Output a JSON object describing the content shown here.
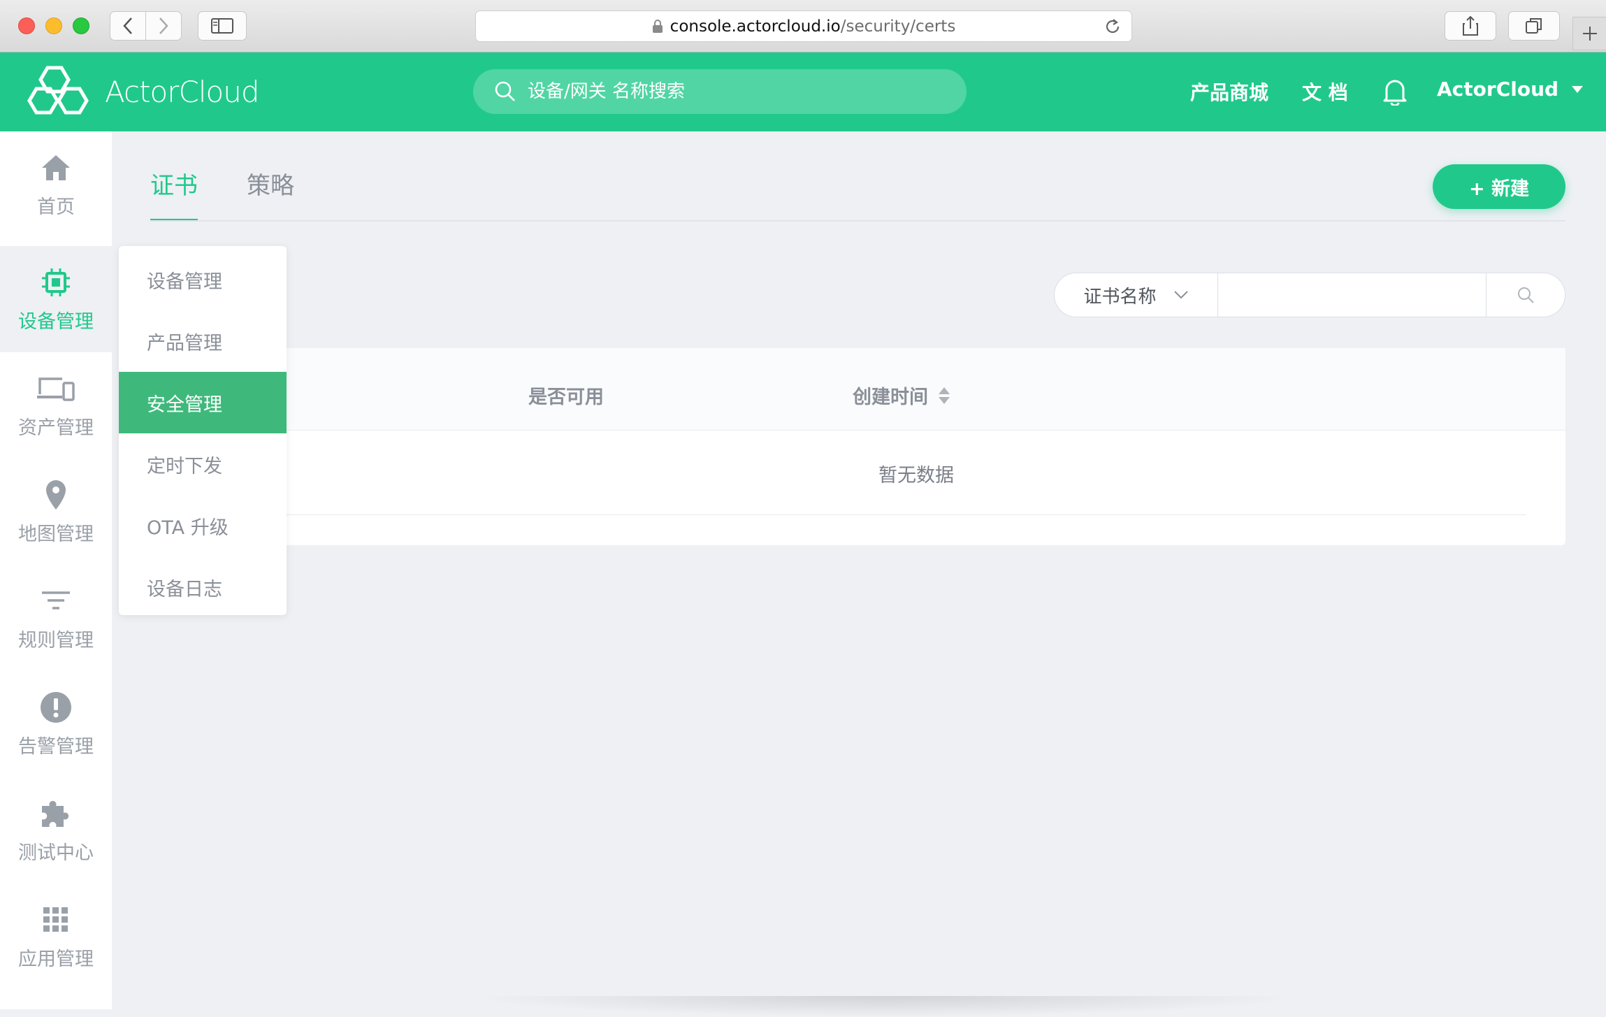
{
  "browser": {
    "url_host": "console.actorcloud.io",
    "url_path": "/security/certs"
  },
  "header": {
    "logo_text": "ActorCloud",
    "search_placeholder": "设备/网关 名称搜索",
    "nav_store": "产品商城",
    "nav_docs": "文 档",
    "user_name": "ActorCloud",
    "brand_color": "#20c98b"
  },
  "sidebar": {
    "items": [
      {
        "label": "首页",
        "icon": "home-icon"
      },
      {
        "label": "设备管理",
        "icon": "chip-icon"
      },
      {
        "label": "资产管理",
        "icon": "devices-icon"
      },
      {
        "label": "地图管理",
        "icon": "map-pin-icon"
      },
      {
        "label": "规则管理",
        "icon": "filter-icon"
      },
      {
        "label": "告警管理",
        "icon": "alert-icon"
      },
      {
        "label": "测试中心",
        "icon": "puzzle-icon"
      },
      {
        "label": "应用管理",
        "icon": "grid-icon"
      }
    ],
    "active_index": 1
  },
  "submenu": {
    "items": [
      "设备管理",
      "产品管理",
      "安全管理",
      "定时下发",
      "OTA 升级",
      "设备日志"
    ],
    "active_index": 2
  },
  "main": {
    "tabs": [
      "证书",
      "策略"
    ],
    "active_tab": 0,
    "new_button": "+ 新建",
    "filter": {
      "select_value": "证书名称",
      "input_value": ""
    },
    "table": {
      "columns": [
        "是否可用",
        "创建时间"
      ],
      "empty_text": "暂无数据"
    }
  }
}
